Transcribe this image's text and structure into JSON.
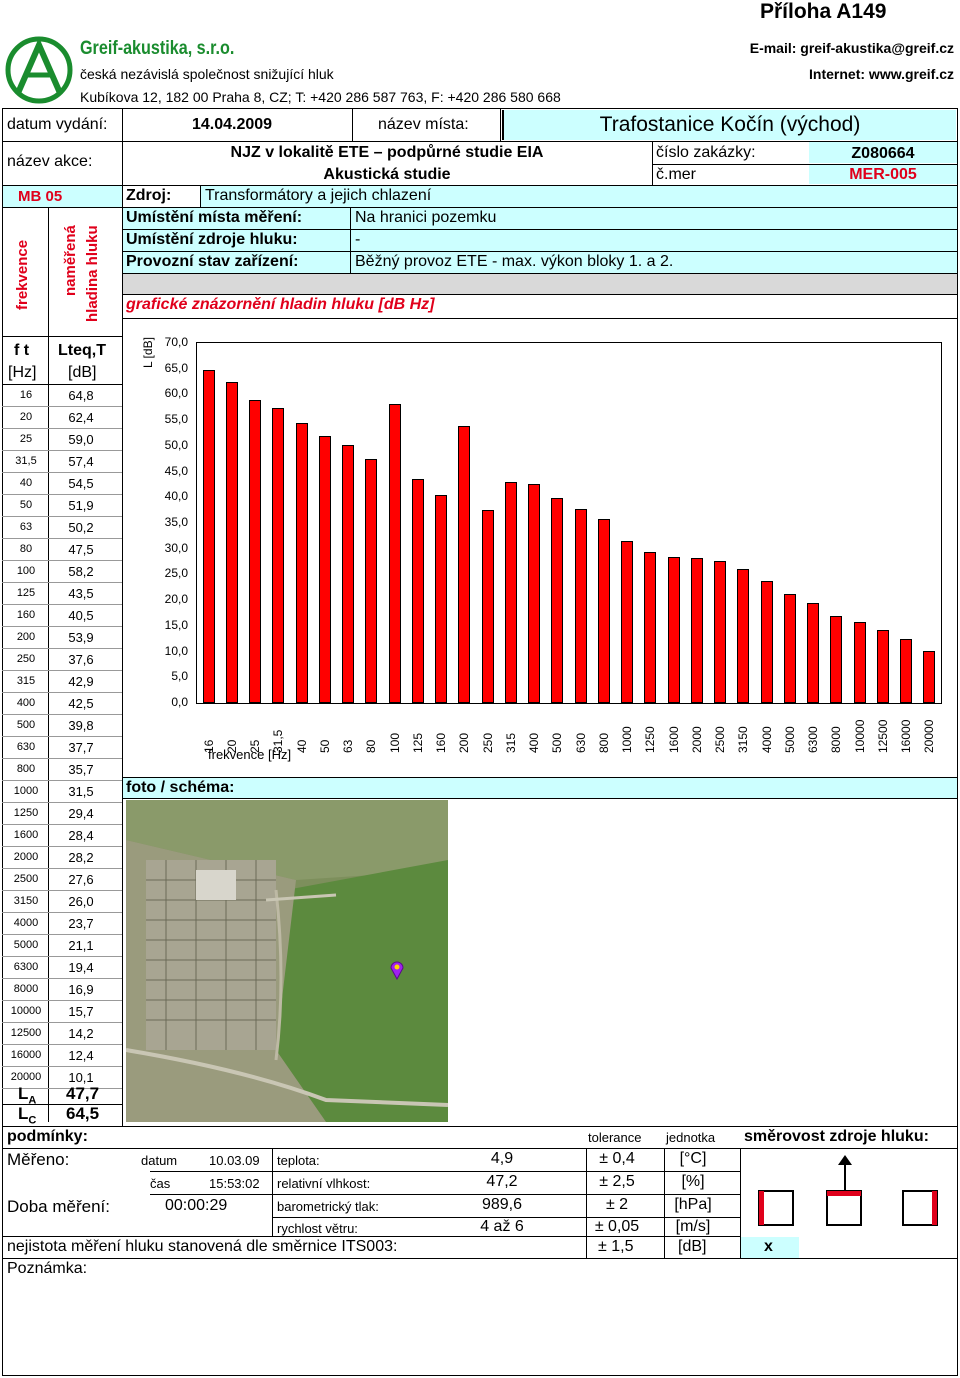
{
  "header": {
    "priloha": "Příloha A149",
    "company": "Greif-akustika, s.r.o.",
    "tagline": "česká nezávislá společnost snižující hluk",
    "address": "Kubíkova 12, 182 00 Praha 8, CZ; T: +420 286 587 763, F: +420 286 580 668",
    "email": "E-mail: greif-akustika@greif.cz",
    "internet": "Internet: www.greif.cz"
  },
  "info": {
    "datum_label": "datum vydání:",
    "datum": "14.04.2009",
    "misto_label": "název místa:",
    "misto": "Trafostanice Kočín (východ)",
    "akce_label": "název akce:",
    "akce_line1": "NJZ v lokalitě ETE – podpůrné studie EIA",
    "akce_line2": "Akustická studie",
    "zakazka_label": "číslo zakázky:",
    "zakazka": "Z080664",
    "mer_label": "č.mer",
    "mer": "MER-005",
    "mb": "MB 05",
    "zdroj_label": "Zdroj:",
    "zdroj": "Transformátory a jejich chlazení",
    "umisteni_mista_label": "Umístění místa měření:",
    "umisteni_mista": "Na hranici pozemku",
    "umisteni_zdroje_label": "Umístění zdroje hluku:",
    "umisteni_zdroje": "-",
    "provozni_label": "Provozní stav zařízení:",
    "provozni": "Běžný provoz ETE - max. výkon bloky 1. a 2.",
    "graf_label": "grafické znázornění hladin hluku [dB  Hz]",
    "frekvence_vert": "frekvence",
    "namerena_vert": "naměřená",
    "hladina_vert": "hladina hluku"
  },
  "table": {
    "h1a": "f t",
    "h1b": "Lteq,T",
    "h2a": "[Hz]",
    "h2b": "[dB]",
    "rows": [
      {
        "f": "16",
        "v": "64,8"
      },
      {
        "f": "20",
        "v": "62,4"
      },
      {
        "f": "25",
        "v": "59,0"
      },
      {
        "f": "31,5",
        "v": "57,4"
      },
      {
        "f": "40",
        "v": "54,5"
      },
      {
        "f": "50",
        "v": "51,9"
      },
      {
        "f": "63",
        "v": "50,2"
      },
      {
        "f": "80",
        "v": "47,5"
      },
      {
        "f": "100",
        "v": "58,2"
      },
      {
        "f": "125",
        "v": "43,5"
      },
      {
        "f": "160",
        "v": "40,5"
      },
      {
        "f": "200",
        "v": "53,9"
      },
      {
        "f": "250",
        "v": "37,6"
      },
      {
        "f": "315",
        "v": "42,9"
      },
      {
        "f": "400",
        "v": "42,5"
      },
      {
        "f": "500",
        "v": "39,8"
      },
      {
        "f": "630",
        "v": "37,7"
      },
      {
        "f": "800",
        "v": "35,7"
      },
      {
        "f": "1000",
        "v": "31,5"
      },
      {
        "f": "1250",
        "v": "29,4"
      },
      {
        "f": "1600",
        "v": "28,4"
      },
      {
        "f": "2000",
        "v": "28,2"
      },
      {
        "f": "2500",
        "v": "27,6"
      },
      {
        "f": "3150",
        "v": "26,0"
      },
      {
        "f": "4000",
        "v": "23,7"
      },
      {
        "f": "5000",
        "v": "21,1"
      },
      {
        "f": "6300",
        "v": "19,4"
      },
      {
        "f": "8000",
        "v": "16,9"
      },
      {
        "f": "10000",
        "v": "15,7"
      },
      {
        "f": "12500",
        "v": "14,2"
      },
      {
        "f": "16000",
        "v": "12,4"
      },
      {
        "f": "20000",
        "v": "10,1"
      }
    ],
    "la_label": "L",
    "la_sub": "A",
    "la": "47,7",
    "lc_label": "L",
    "lc_sub": "C",
    "lc": "64,5"
  },
  "chart_data": {
    "type": "bar",
    "ylabel": "L [dB]",
    "xlabel": "frekvence [Hz]",
    "ylim": [
      0,
      70
    ],
    "yticks": [
      "0,0",
      "5,0",
      "10,0",
      "15,0",
      "20,0",
      "25,0",
      "30,0",
      "35,0",
      "40,0",
      "45,0",
      "50,0",
      "55,0",
      "60,0",
      "65,0",
      "70,0"
    ],
    "categories": [
      "16",
      "20",
      "25",
      "31,5",
      "40",
      "50",
      "63",
      "80",
      "100",
      "125",
      "160",
      "200",
      "250",
      "315",
      "400",
      "500",
      "630",
      "800",
      "1000",
      "1250",
      "1600",
      "2000",
      "2500",
      "3150",
      "4000",
      "5000",
      "6300",
      "8000",
      "10000",
      "12500",
      "16000",
      "20000"
    ],
    "values": [
      64.8,
      62.4,
      59.0,
      57.4,
      54.5,
      51.9,
      50.2,
      47.5,
      58.2,
      43.5,
      40.5,
      53.9,
      37.6,
      42.9,
      42.5,
      39.8,
      37.7,
      35.7,
      31.5,
      29.4,
      28.4,
      28.2,
      27.6,
      26.0,
      23.7,
      21.1,
      19.4,
      16.9,
      15.7,
      14.2,
      12.4,
      10.1
    ],
    "color": "#ff0000",
    "grid": false
  },
  "photo": {
    "label": "foto / schéma:"
  },
  "conditions": {
    "podminky": "podmínky:",
    "tolerance": "tolerance",
    "jednotka": "jednotka",
    "smerovost": "směrovost zdroje hluku:",
    "mereno": "Měřeno:",
    "datum_label": "datum",
    "datum": "10.03.09",
    "cas_label": "čas",
    "cas": "15:53:02",
    "doba_label": "Doba měření:",
    "doba": "00:00:29",
    "params": [
      {
        "name": "teplota:",
        "value": "4,9",
        "tol": "± 0,4",
        "unit": "[°C]"
      },
      {
        "name": "relativní vlhkost:",
        "value": "47,2",
        "tol": "± 2,5",
        "unit": "[%]"
      },
      {
        "name": "barometrický tlak:",
        "value": "989,6",
        "tol": "± 2",
        "unit": "[hPa]"
      },
      {
        "name": "rychlost větru:",
        "value": "4 až 6",
        "tol": "± 0,05",
        "unit": "[m/s]"
      }
    ],
    "nejistota_label": "nejistota měření hluku stanovená dle směrnice ITS003:",
    "nejistota_tol": "± 1,5",
    "nejistota_unit": "[dB]",
    "x_mark": "x",
    "poznamka": "Poznámka:"
  },
  "colors": {
    "cyan": "#ccffff",
    "bar": "#ff0000",
    "red_text": "#e0001b",
    "logo_green": "#1a8c2e"
  }
}
